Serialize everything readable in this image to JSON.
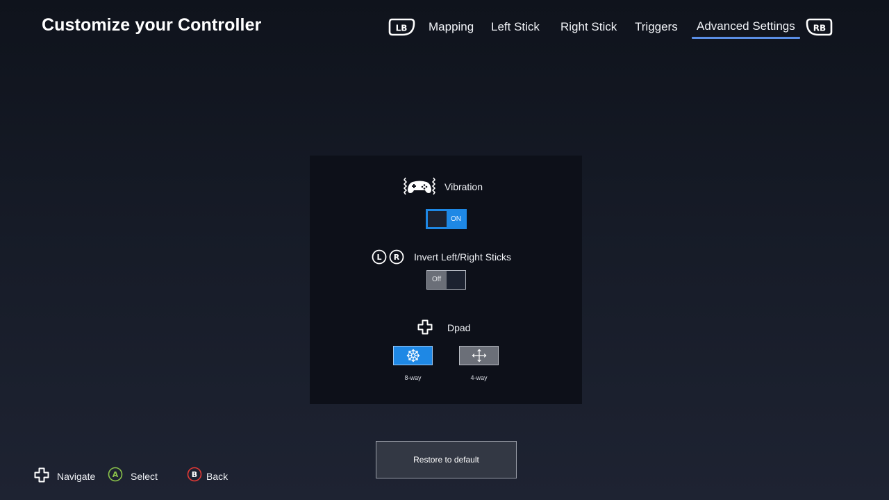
{
  "header": {
    "title": "Customize your Controller"
  },
  "tabs": {
    "prev_bumper": "LB",
    "next_bumper": "RB",
    "items": [
      {
        "label": "Mapping"
      },
      {
        "label": "Left Stick"
      },
      {
        "label": "Right Stick"
      },
      {
        "label": "Triggers"
      },
      {
        "label": "Advanced Settings"
      }
    ],
    "active_index": 4
  },
  "settings": {
    "vibration": {
      "icon": "vibration-controller-icon",
      "label": "Vibration",
      "state_label": "ON",
      "enabled": true
    },
    "invert_sticks": {
      "icon_left": "L",
      "icon_right": "R",
      "label": "Invert Left/Right Sticks",
      "state_label": "Off",
      "enabled": false
    },
    "dpad": {
      "icon": "dpad-icon",
      "label": "Dpad",
      "options": [
        {
          "label": "8-way",
          "icon": "eight-way-arrows-icon"
        },
        {
          "label": "4-way",
          "icon": "four-way-arrows-icon"
        }
      ],
      "selected": "8-way"
    }
  },
  "restore": {
    "label": "Restore to default"
  },
  "footer": {
    "hints": [
      {
        "glyph": "",
        "icon": "dpad-icon",
        "label": "Navigate"
      },
      {
        "glyph": "A",
        "icon": "a-button-icon",
        "label": "Select"
      },
      {
        "glyph": "B",
        "icon": "b-button-icon",
        "label": "Back"
      }
    ]
  },
  "colors": {
    "accent": "#1e88e5",
    "tab_underline": "#5a8ee6",
    "a_button": "#8bc34a",
    "b_button": "#e53935",
    "panel": "#0d1019"
  }
}
